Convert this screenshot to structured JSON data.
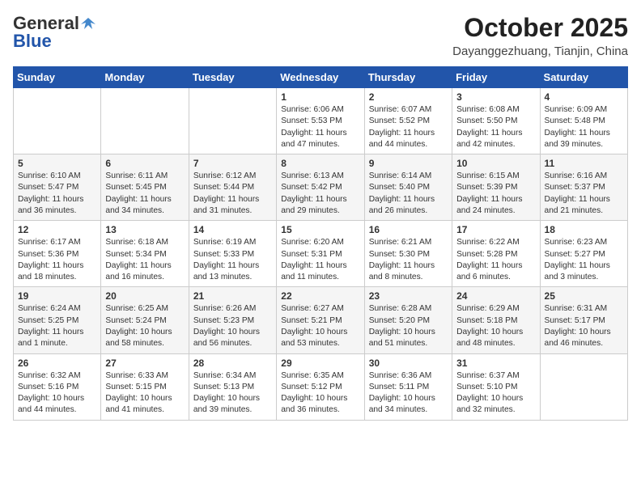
{
  "header": {
    "logo_general": "General",
    "logo_blue": "Blue",
    "month": "October 2025",
    "location": "Dayanggezhuang, Tianjin, China"
  },
  "days_of_week": [
    "Sunday",
    "Monday",
    "Tuesday",
    "Wednesday",
    "Thursday",
    "Friday",
    "Saturday"
  ],
  "weeks": [
    [
      {
        "day": "",
        "text": ""
      },
      {
        "day": "",
        "text": ""
      },
      {
        "day": "",
        "text": ""
      },
      {
        "day": "1",
        "text": "Sunrise: 6:06 AM\nSunset: 5:53 PM\nDaylight: 11 hours and 47 minutes."
      },
      {
        "day": "2",
        "text": "Sunrise: 6:07 AM\nSunset: 5:52 PM\nDaylight: 11 hours and 44 minutes."
      },
      {
        "day": "3",
        "text": "Sunrise: 6:08 AM\nSunset: 5:50 PM\nDaylight: 11 hours and 42 minutes."
      },
      {
        "day": "4",
        "text": "Sunrise: 6:09 AM\nSunset: 5:48 PM\nDaylight: 11 hours and 39 minutes."
      }
    ],
    [
      {
        "day": "5",
        "text": "Sunrise: 6:10 AM\nSunset: 5:47 PM\nDaylight: 11 hours and 36 minutes."
      },
      {
        "day": "6",
        "text": "Sunrise: 6:11 AM\nSunset: 5:45 PM\nDaylight: 11 hours and 34 minutes."
      },
      {
        "day": "7",
        "text": "Sunrise: 6:12 AM\nSunset: 5:44 PM\nDaylight: 11 hours and 31 minutes."
      },
      {
        "day": "8",
        "text": "Sunrise: 6:13 AM\nSunset: 5:42 PM\nDaylight: 11 hours and 29 minutes."
      },
      {
        "day": "9",
        "text": "Sunrise: 6:14 AM\nSunset: 5:40 PM\nDaylight: 11 hours and 26 minutes."
      },
      {
        "day": "10",
        "text": "Sunrise: 6:15 AM\nSunset: 5:39 PM\nDaylight: 11 hours and 24 minutes."
      },
      {
        "day": "11",
        "text": "Sunrise: 6:16 AM\nSunset: 5:37 PM\nDaylight: 11 hours and 21 minutes."
      }
    ],
    [
      {
        "day": "12",
        "text": "Sunrise: 6:17 AM\nSunset: 5:36 PM\nDaylight: 11 hours and 18 minutes."
      },
      {
        "day": "13",
        "text": "Sunrise: 6:18 AM\nSunset: 5:34 PM\nDaylight: 11 hours and 16 minutes."
      },
      {
        "day": "14",
        "text": "Sunrise: 6:19 AM\nSunset: 5:33 PM\nDaylight: 11 hours and 13 minutes."
      },
      {
        "day": "15",
        "text": "Sunrise: 6:20 AM\nSunset: 5:31 PM\nDaylight: 11 hours and 11 minutes."
      },
      {
        "day": "16",
        "text": "Sunrise: 6:21 AM\nSunset: 5:30 PM\nDaylight: 11 hours and 8 minutes."
      },
      {
        "day": "17",
        "text": "Sunrise: 6:22 AM\nSunset: 5:28 PM\nDaylight: 11 hours and 6 minutes."
      },
      {
        "day": "18",
        "text": "Sunrise: 6:23 AM\nSunset: 5:27 PM\nDaylight: 11 hours and 3 minutes."
      }
    ],
    [
      {
        "day": "19",
        "text": "Sunrise: 6:24 AM\nSunset: 5:25 PM\nDaylight: 11 hours and 1 minute."
      },
      {
        "day": "20",
        "text": "Sunrise: 6:25 AM\nSunset: 5:24 PM\nDaylight: 10 hours and 58 minutes."
      },
      {
        "day": "21",
        "text": "Sunrise: 6:26 AM\nSunset: 5:23 PM\nDaylight: 10 hours and 56 minutes."
      },
      {
        "day": "22",
        "text": "Sunrise: 6:27 AM\nSunset: 5:21 PM\nDaylight: 10 hours and 53 minutes."
      },
      {
        "day": "23",
        "text": "Sunrise: 6:28 AM\nSunset: 5:20 PM\nDaylight: 10 hours and 51 minutes."
      },
      {
        "day": "24",
        "text": "Sunrise: 6:29 AM\nSunset: 5:18 PM\nDaylight: 10 hours and 48 minutes."
      },
      {
        "day": "25",
        "text": "Sunrise: 6:31 AM\nSunset: 5:17 PM\nDaylight: 10 hours and 46 minutes."
      }
    ],
    [
      {
        "day": "26",
        "text": "Sunrise: 6:32 AM\nSunset: 5:16 PM\nDaylight: 10 hours and 44 minutes."
      },
      {
        "day": "27",
        "text": "Sunrise: 6:33 AM\nSunset: 5:15 PM\nDaylight: 10 hours and 41 minutes."
      },
      {
        "day": "28",
        "text": "Sunrise: 6:34 AM\nSunset: 5:13 PM\nDaylight: 10 hours and 39 minutes."
      },
      {
        "day": "29",
        "text": "Sunrise: 6:35 AM\nSunset: 5:12 PM\nDaylight: 10 hours and 36 minutes."
      },
      {
        "day": "30",
        "text": "Sunrise: 6:36 AM\nSunset: 5:11 PM\nDaylight: 10 hours and 34 minutes."
      },
      {
        "day": "31",
        "text": "Sunrise: 6:37 AM\nSunset: 5:10 PM\nDaylight: 10 hours and 32 minutes."
      },
      {
        "day": "",
        "text": ""
      }
    ]
  ]
}
